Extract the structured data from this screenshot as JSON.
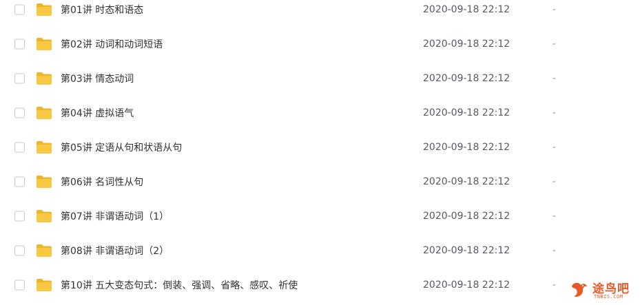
{
  "files": [
    {
      "name": "第01讲 时态和语态",
      "date": "2020-09-18 22:12",
      "size": "-"
    },
    {
      "name": "第02讲 动词和动词短语",
      "date": "2020-09-18 22:12",
      "size": "-"
    },
    {
      "name": "第03讲 情态动词",
      "date": "2020-09-18 22:12",
      "size": "-"
    },
    {
      "name": "第04讲 虚拟语气",
      "date": "2020-09-18 22:12",
      "size": "-"
    },
    {
      "name": "第05讲 定语从句和状语从句",
      "date": "2020-09-18 22:12",
      "size": "-"
    },
    {
      "name": "第06讲 名词性从句",
      "date": "2020-09-18 22:12",
      "size": "-"
    },
    {
      "name": "第07讲 非谓语动词（1）",
      "date": "2020-09-18 22:12",
      "size": "-"
    },
    {
      "name": "第08讲 非谓语动词（2）",
      "date": "2020-09-18 22:12",
      "size": "-"
    },
    {
      "name": "第10讲 五大变态句式：倒装、强调、省略、感叹、祈使",
      "date": "2020-09-18 22:12",
      "size": "-"
    }
  ],
  "watermark": {
    "name": "途鸟吧",
    "domain": "TNBZS.COM"
  },
  "colors": {
    "folder": "#f7c842",
    "folder_dark": "#f0b429",
    "watermark": "#e85a24"
  },
  "icons": {
    "folder": "folder-icon",
    "checkbox": "checkbox-icon",
    "watermark": "bird-logo-icon"
  }
}
